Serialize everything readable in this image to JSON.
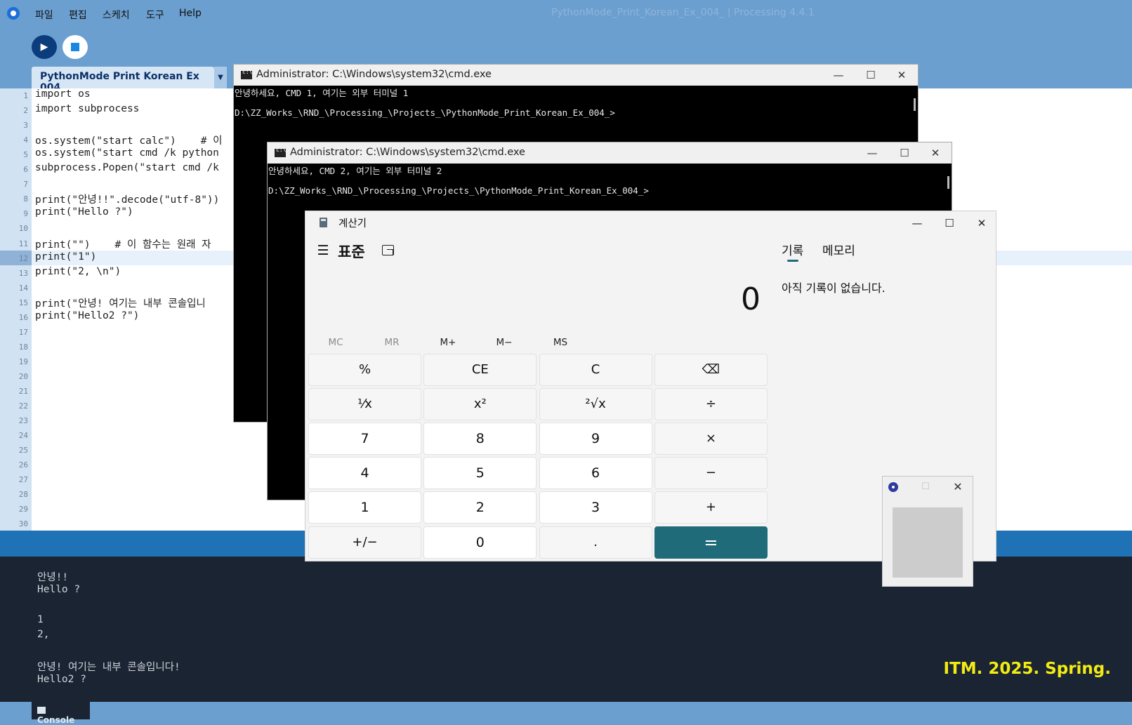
{
  "ide": {
    "menu": [
      "파일",
      "편집",
      "스케치",
      "도구",
      "Help"
    ],
    "title": "PythonMode_Print_Korean_Ex_004_ | Processing 4.4.1",
    "run_icon": "▶",
    "tab_label": "PythonMode Print Korean Ex 004",
    "tab_arrow": "▼",
    "lines": [
      "import os",
      "import subprocess",
      "",
      "os.system(\"start calc\")    # 이",
      "os.system(\"start cmd /k python",
      "subprocess.Popen(\"start cmd /k ",
      "",
      "print(\"안녕!!\".decode(\"utf-8\"))",
      "print(\"Hello ?\")",
      "",
      "print(\"\")    # 이 함수는 원래 자",
      "print(\"1\")",
      "print(\"2, \\n\")",
      "",
      "print(\"안녕! 여기는 내부 콘솔입니",
      "print(\"Hello2 ?\")"
    ],
    "line_numbers": [
      "1",
      "2",
      "3",
      "4",
      "5",
      "6",
      "7",
      "8",
      "9",
      "10",
      "11",
      "12",
      "13",
      "14",
      "15",
      "16",
      "17",
      "18",
      "19",
      "20",
      "21",
      "22",
      "23",
      "24",
      "25",
      "26",
      "27",
      "28",
      "29",
      "30"
    ],
    "console_lines": [
      "안녕!!",
      "Hello ?",
      "",
      "1",
      "2,",
      "",
      "안녕! 여기는 내부 콘솔입니다!",
      "Hello2 ?"
    ],
    "console_tab": "Console",
    "watermark": "ITM. 2025. Spring.",
    "colors": {
      "background": "#6b9fcf",
      "console": "#1b2433",
      "watermark": "#f2ec13"
    }
  },
  "cmd1": {
    "title": "Administrator: C:\\Windows\\system32\\cmd.exe",
    "line1": "안녕하세요, CMD 1, 여기는 외부 터미널 1",
    "prompt": "D:\\ZZ_Works_\\RND_\\Processing_\\Projects_\\PythonMode_Print_Korean_Ex_004_>"
  },
  "cmd2": {
    "title": "Administrator: C:\\Windows\\system32\\cmd.exe",
    "line1": "안녕하세요, CMD 2, 여기는 외부 터미널 2",
    "prompt": "D:\\ZZ_Works_\\RND_\\Processing_\\Projects_\\PythonMode_Print_Korean_Ex_004_>"
  },
  "window_controls": {
    "minimize": "—",
    "maximize": "☐",
    "close": "✕"
  },
  "calc": {
    "title": "계산기",
    "menu_icon": "☰",
    "mode": "표준",
    "display": "0",
    "memory": [
      "MC",
      "MR",
      "M+",
      "M−",
      "MS"
    ],
    "keys": [
      "%",
      "CE",
      "C",
      "⌫",
      "⅟x",
      "x²",
      "²√x",
      "÷",
      "7",
      "8",
      "9",
      "×",
      "4",
      "5",
      "6",
      "−",
      "1",
      "2",
      "3",
      "+",
      "+/−",
      "0",
      ".",
      "="
    ],
    "tab_history": "기록",
    "tab_memory": "메모리",
    "history_empty": "아직 기록이 없습니다.",
    "accent": "#1f6b7a"
  },
  "small_window": {
    "close": "✕",
    "maximize": "☐"
  }
}
